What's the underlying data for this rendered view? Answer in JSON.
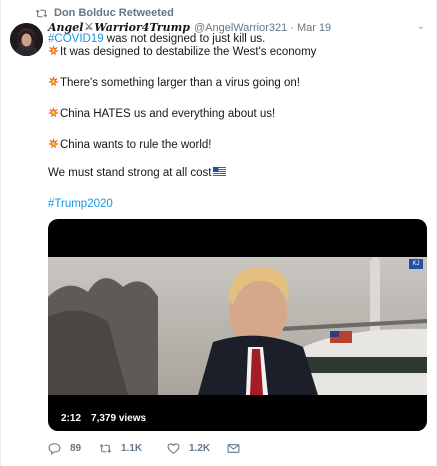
{
  "retweet_context": {
    "icon": "retweet-icon",
    "text": "Don Bolduc Retweeted"
  },
  "tweet": {
    "display_name_part1": "Angel",
    "display_name_separator_icon": "crossed-swords-icon",
    "display_name_part2": "Warrior4Trump",
    "handle": "@AngelWarrior321",
    "separator": "·",
    "time": "Mar 19",
    "line1_hashtag": "#COVID19",
    "line1_rest": " was not designed to just kill us.",
    "line2": "It was designed to destabilize the West's economy",
    "line3": "There's something larger than a virus going on!",
    "line4": "China HATES us and everything about us!",
    "line5": "China wants to rule the world!",
    "line6": "We must stand strong at all cost",
    "line7_hashtag": "#Trump2020",
    "bullet_icon": "collision-emoji-icon",
    "flag_icon": "us-flag-emoji-icon"
  },
  "video": {
    "duration": "2:12",
    "views": "7,379 views"
  },
  "actions": {
    "reply_count": "89",
    "retweet_count": "1.1K",
    "like_count": "1.2K"
  },
  "colors": {
    "link": "#1b95e0",
    "muted": "#657786",
    "text": "#14171a"
  }
}
